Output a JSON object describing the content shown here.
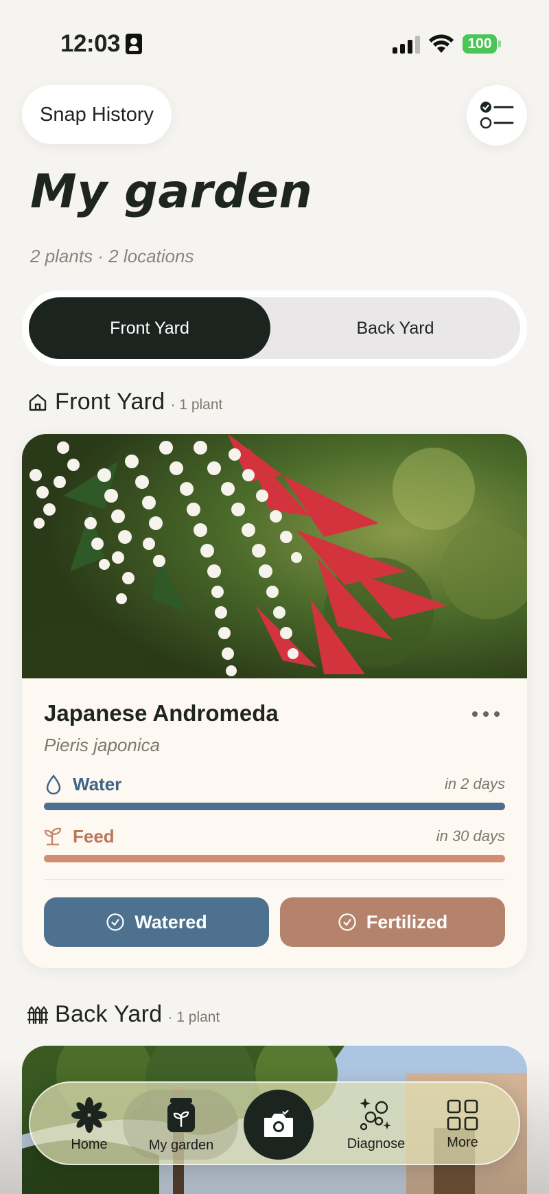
{
  "status_bar": {
    "time": "12:03",
    "battery": "100"
  },
  "header": {
    "snap_history_label": "Snap History"
  },
  "page": {
    "title": "My garden",
    "subtitle": "2 plants · 2 locations"
  },
  "location_tabs": [
    {
      "label": "Front Yard",
      "active": true
    },
    {
      "label": "Back Yard",
      "active": false
    }
  ],
  "sections": [
    {
      "title": "Front Yard",
      "count": "· 1 plant",
      "icon": "house-icon"
    },
    {
      "title": "Back Yard",
      "count": "· 1 plant",
      "icon": "fence-icon"
    }
  ],
  "plant": {
    "name": "Japanese Andromeda",
    "scientific_name": "Pieris japonica",
    "water": {
      "label": "Water",
      "when": "in 2 days",
      "color": "#3e6386",
      "progress": 1.0
    },
    "feed": {
      "label": "Feed",
      "when": "in 30 days",
      "color": "#c7896a",
      "progress": 1.0
    },
    "watered_button": "Watered",
    "fertilized_button": "Fertilized"
  },
  "tab_bar": [
    {
      "label": "Home",
      "icon": "flower-icon"
    },
    {
      "label": "My garden",
      "icon": "plant-pot-icon",
      "selected": true
    },
    {
      "label": "",
      "icon": "camera-icon"
    },
    {
      "label": "Diagnose",
      "icon": "sparkle-diagnose-icon"
    },
    {
      "label": "More",
      "icon": "grid-icon"
    }
  ],
  "colors": {
    "background": "#f6f4f1",
    "primary_dark": "#1c2420",
    "water_button": "#4e7190",
    "fertilize_button": "#b5836b"
  }
}
